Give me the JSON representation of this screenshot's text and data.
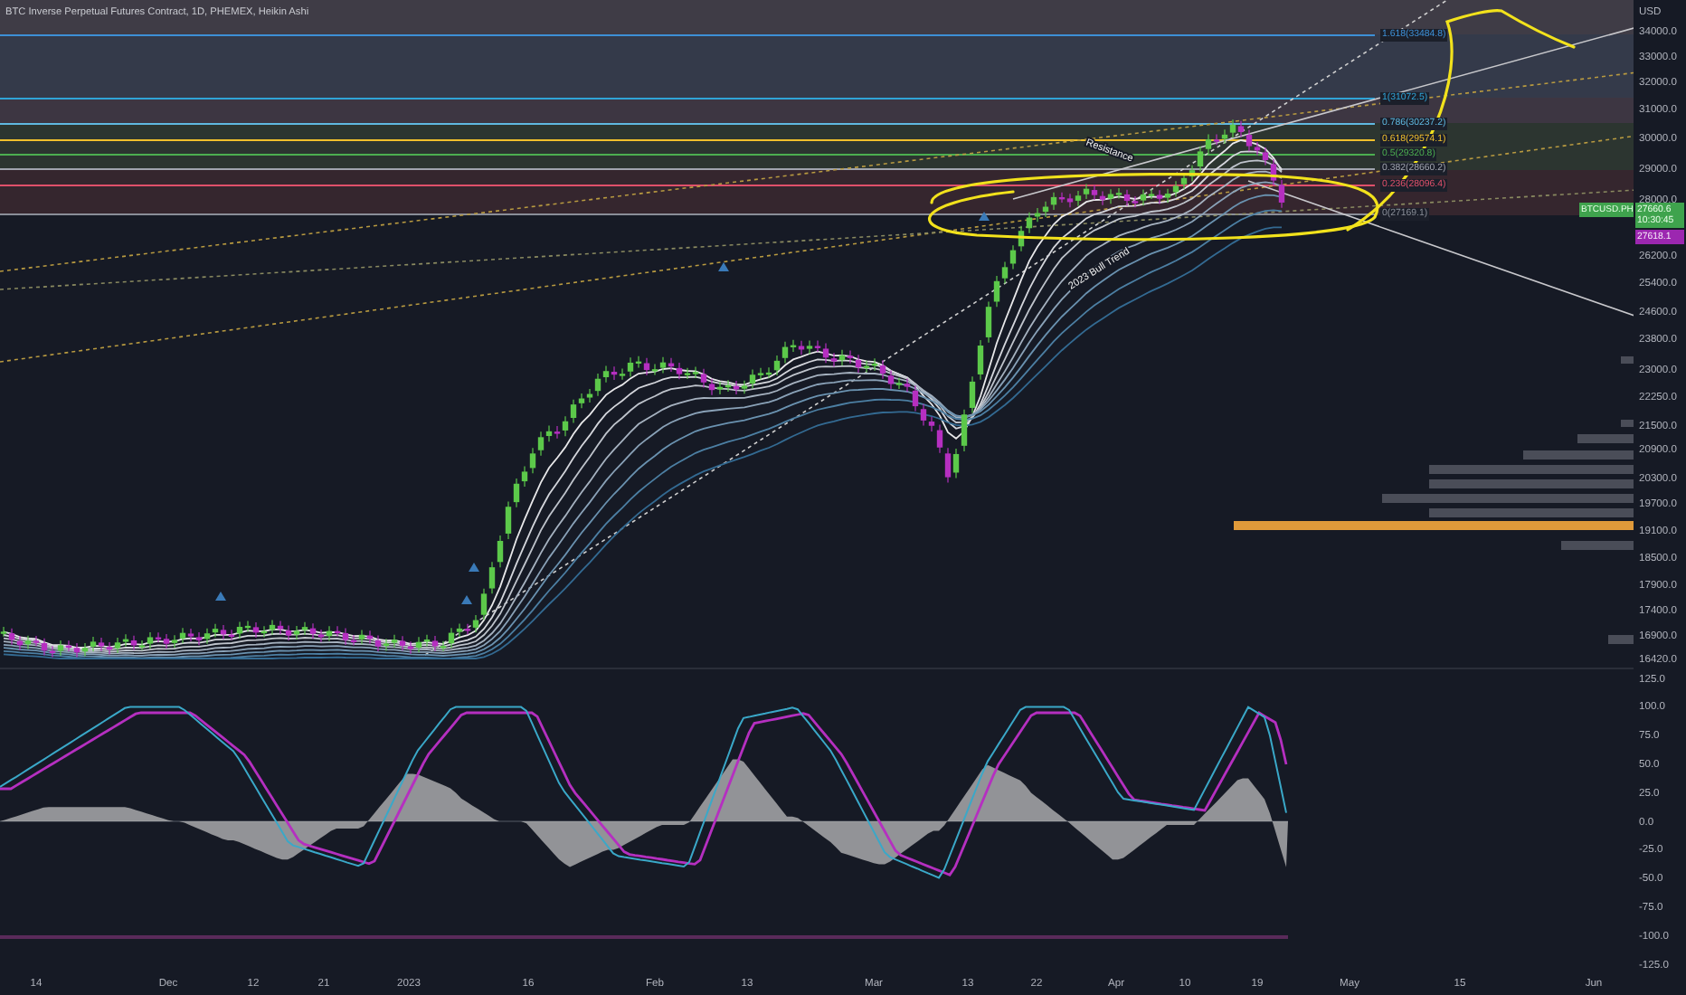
{
  "chart_title": "BTC Inverse Perpetual Futures Contract, 1D, PHEMEX, Heikin Ashi",
  "price_axis": {
    "currency": "USD",
    "labels": [
      "34000.0",
      "33000.0",
      "32000.0",
      "31000.0",
      "30000.0",
      "29000.0",
      "28000.0",
      "26200.0",
      "25400.0",
      "24600.0",
      "23800.0",
      "23000.0",
      "22250.0",
      "21500.0",
      "20900.0",
      "20300.0",
      "19700.0",
      "19100.0",
      "18500.0",
      "17900.0",
      "17400.0",
      "16900.0",
      "16420.0"
    ]
  },
  "symbol_tag": "BTCUSD.PH",
  "last_price": {
    "price": "27660.6",
    "countdown": "10:30:45"
  },
  "secondary_price": "27618.1",
  "fib_levels": [
    {
      "label": "1.618(33484.8)",
      "color": "#3d8fd6"
    },
    {
      "label": "1(31072.5)",
      "color": "#2fa4d8"
    },
    {
      "label": "0.786(30237.2)",
      "color": "#5fb8e0"
    },
    {
      "label": "0.618(29574.1)",
      "color": "#f0c02c"
    },
    {
      "label": "0.5(29320.8)",
      "color": "#4caf50"
    },
    {
      "label": "0.382(28660.2)",
      "color": "#a0a4ae"
    },
    {
      "label": "0.236(28096.4)",
      "color": "#e0506a"
    },
    {
      "label": "0(27169.1)",
      "color": "#8a8e98"
    }
  ],
  "annotations": [
    "Resistance",
    "2023 Bull Trend"
  ],
  "oscillator_axis": [
    "125.0",
    "100.0",
    "75.0",
    "50.0",
    "25.0",
    "0.0",
    "-25.0",
    "-50.0",
    "-75.0",
    "-100.0",
    "-125.0"
  ],
  "time_axis": [
    "14",
    "Dec",
    "12",
    "21",
    "2023",
    "16",
    "Feb",
    "13",
    "Mar",
    "13",
    "22",
    "Apr",
    "10",
    "19",
    "May",
    "15",
    "Jun"
  ]
}
